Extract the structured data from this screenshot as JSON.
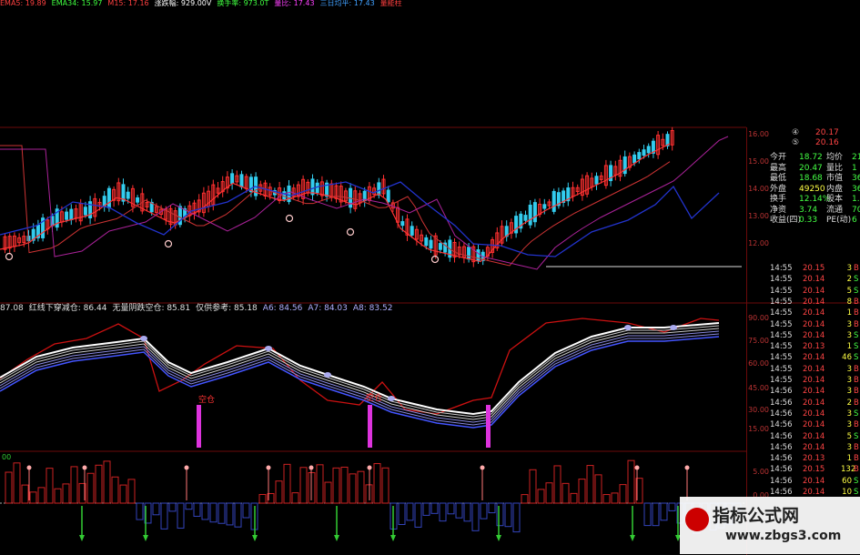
{
  "top_legend": [
    {
      "text": "EMA5: 19.89",
      "color": "#ff4040"
    },
    {
      "text": "EMA34: 15.97",
      "color": "#40ff40"
    },
    {
      "text": "M15: 17.16",
      "color": "#ff4040"
    },
    {
      "text": "涨跌幅: 929.00V",
      "color": "#ffffff"
    },
    {
      "text": "换手率: 973.0T",
      "color": "#40ff40"
    },
    {
      "text": "量比: 17.43",
      "color": "#ff40ff"
    },
    {
      "text": "三日均平: 17.43",
      "color": "#40a0ff"
    },
    {
      "text": "量能柱",
      "color": "#ff4040"
    }
  ],
  "indicator_legend": [
    {
      "text": "87.08",
      "color": "#dddddd"
    },
    {
      "text": "红线下穿减仓: 86.44",
      "color": "#e0e0e0"
    },
    {
      "text": "无量阴跌空仓: 85.81",
      "color": "#e0e0e0"
    },
    {
      "text": "仅供参考: 85.18",
      "color": "#e0e0e0"
    },
    {
      "text": "A6: 84.56",
      "color": "#b0b0ff"
    },
    {
      "text": "A7: 84.03",
      "color": "#b0b0ff"
    },
    {
      "text": "A8: 83.52",
      "color": "#b0b0ff"
    }
  ],
  "left_label": "00",
  "annotation_label": "空仓",
  "price_axis": [
    "16.00",
    "15.00",
    "14.00",
    "13.00",
    "12.00"
  ],
  "osc_axis": [
    "90.00",
    "75.00",
    "60.00",
    "45.00",
    "30.00",
    "15.00"
  ],
  "vol_axis": [
    "5.00",
    "0.00"
  ],
  "quote_top": [
    {
      "icon": "④",
      "value": "20.17"
    },
    {
      "icon": "⑤",
      "value": "20.16"
    }
  ],
  "quote_info": [
    {
      "l1": "今开",
      "v1": "18.72",
      "l2": "均价",
      "v2": "21"
    },
    {
      "l1": "最高",
      "v1": "20.47",
      "l2": "量比",
      "v2": "1"
    },
    {
      "l1": "最低",
      "v1": "18.68",
      "l2": "市值",
      "v2": "36."
    },
    {
      "l1": "外盘",
      "v1": "49250",
      "l2": "内盘",
      "v2": "36"
    },
    {
      "l1": "换手",
      "v1": "12.14%",
      "l2": "股本",
      "v2": "1.7"
    },
    {
      "l1": "净资",
      "v1": "3.74",
      "l2": "流通",
      "v2": "705"
    },
    {
      "l1": "收益(四)",
      "v1": "0.33",
      "l2": "PE(动)",
      "v2": "6"
    }
  ],
  "ticks": [
    {
      "t": "14:55",
      "p": "20.15",
      "v": "3",
      "d": "B"
    },
    {
      "t": "14:55",
      "p": "20.14",
      "v": "2",
      "d": "S"
    },
    {
      "t": "14:55",
      "p": "20.14",
      "v": "5",
      "d": "S"
    },
    {
      "t": "14:55",
      "p": "20.14",
      "v": "8",
      "d": "B"
    },
    {
      "t": "14:55",
      "p": "20.14",
      "v": "1",
      "d": "B"
    },
    {
      "t": "14:55",
      "p": "20.14",
      "v": "3",
      "d": "B"
    },
    {
      "t": "14:55",
      "p": "20.14",
      "v": "3",
      "d": "S"
    },
    {
      "t": "14:55",
      "p": "20.13",
      "v": "1",
      "d": "S"
    },
    {
      "t": "14:55",
      "p": "20.14",
      "v": "46",
      "d": "S"
    },
    {
      "t": "14:55",
      "p": "20.14",
      "v": "3",
      "d": "B"
    },
    {
      "t": "14:55",
      "p": "20.14",
      "v": "3",
      "d": "B"
    },
    {
      "t": "14:56",
      "p": "20.14",
      "v": "3",
      "d": "B"
    },
    {
      "t": "14:56",
      "p": "20.14",
      "v": "2",
      "d": "B"
    },
    {
      "t": "14:56",
      "p": "20.14",
      "v": "3",
      "d": "S"
    },
    {
      "t": "14:56",
      "p": "20.14",
      "v": "3",
      "d": "B"
    },
    {
      "t": "14:56",
      "p": "20.14",
      "v": "5",
      "d": "S"
    },
    {
      "t": "14:56",
      "p": "20.14",
      "v": "3",
      "d": "B"
    },
    {
      "t": "14:56",
      "p": "20.13",
      "v": "1",
      "d": "B"
    },
    {
      "t": "14:56",
      "p": "20.15",
      "v": "132",
      "d": "B"
    },
    {
      "t": "14:56",
      "p": "20.14",
      "v": "60",
      "d": "S"
    },
    {
      "t": "14:56",
      "p": "20.14",
      "v": "10",
      "d": "S"
    }
  ],
  "watermark": {
    "title": "指标公式网",
    "url": "www.zbgs3.com"
  },
  "colors": {
    "up": "#ff3030",
    "down": "#33ccee",
    "bg": "#000000",
    "grid": "#6b0a0a",
    "ma_blue": "#2233cc",
    "ma_purple": "#9933aa",
    "signal": "#dd33dd"
  }
}
